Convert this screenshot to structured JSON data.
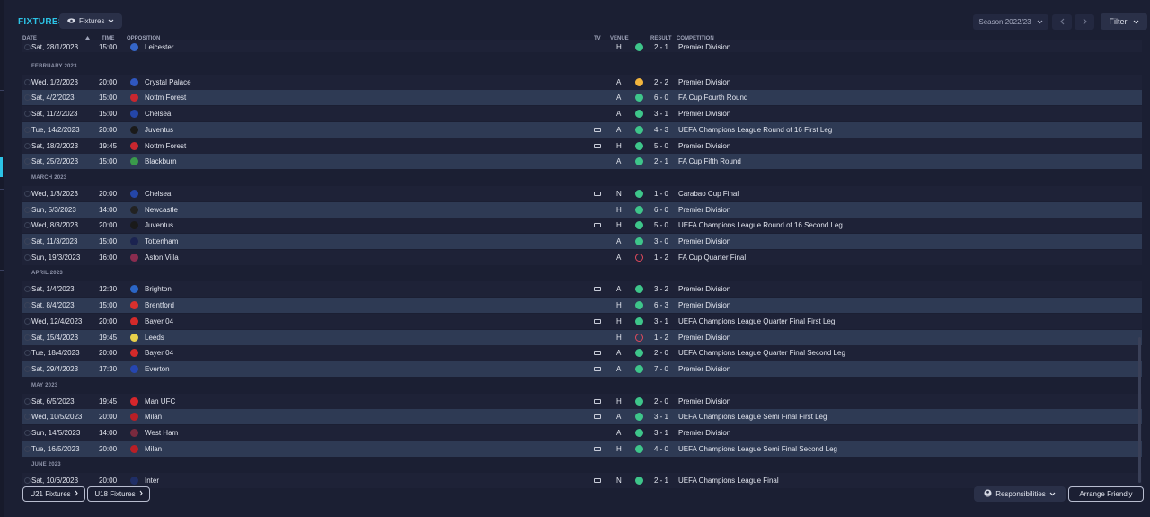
{
  "header": {
    "title": "FIXTURES",
    "view_dropdown": "Fixtures",
    "season": "Season 2022/23",
    "filter_label": "Filter"
  },
  "columns": {
    "date": "DATE",
    "time": "TIME",
    "opposition": "OPPOSITION",
    "tv": "TV",
    "venue": "VENUE",
    "result": "RESULT",
    "competition": "COMPETITION"
  },
  "fixtures": [
    {
      "date": "Sat, 28/1/2023",
      "time": "15:00",
      "opp": "Leicester",
      "tv": false,
      "venue": "H",
      "outcome": "win",
      "score": "2 - 1",
      "comp": "Premier Division",
      "crest": "#3566c9"
    },
    {
      "month": "FEBRUARY 2023"
    },
    {
      "date": "Wed, 1/2/2023",
      "time": "20:00",
      "opp": "Crystal Palace",
      "tv": false,
      "venue": "A",
      "outcome": "draw",
      "score": "2 - 2",
      "comp": "Premier Division",
      "crest": "#2f57c0"
    },
    {
      "date": "Sat, 4/2/2023",
      "time": "15:00",
      "opp": "Nottm Forest",
      "tv": false,
      "venue": "A",
      "outcome": "win",
      "score": "6 - 0",
      "comp": "FA Cup Fourth Round",
      "crest": "#c8272f"
    },
    {
      "date": "Sat, 11/2/2023",
      "time": "15:00",
      "opp": "Chelsea",
      "tv": false,
      "venue": "A",
      "outcome": "win",
      "score": "3 - 1",
      "comp": "Premier Division",
      "crest": "#2446a8"
    },
    {
      "date": "Tue, 14/2/2023",
      "time": "20:00",
      "opp": "Juventus",
      "tv": true,
      "venue": "A",
      "outcome": "win",
      "score": "4 - 3",
      "comp": "UEFA Champions League Round of 16  First Leg",
      "crest": "#1a1a1a"
    },
    {
      "date": "Sat, 18/2/2023",
      "time": "19:45",
      "opp": "Nottm Forest",
      "tv": true,
      "venue": "H",
      "outcome": "win",
      "score": "5 - 0",
      "comp": "Premier Division",
      "crest": "#c8272f"
    },
    {
      "date": "Sat, 25/2/2023",
      "time": "15:00",
      "opp": "Blackburn",
      "tv": false,
      "venue": "A",
      "outcome": "win",
      "score": "2 - 1",
      "comp": "FA Cup Fifth Round",
      "crest": "#3a9a4b"
    },
    {
      "month": "MARCH 2023"
    },
    {
      "date": "Wed, 1/3/2023",
      "time": "20:00",
      "opp": "Chelsea",
      "tv": true,
      "venue": "N",
      "outcome": "win",
      "score": "1 - 0",
      "comp": "Carabao Cup Final",
      "crest": "#2446a8"
    },
    {
      "date": "Sun, 5/3/2023",
      "time": "14:00",
      "opp": "Newcastle",
      "tv": false,
      "venue": "H",
      "outcome": "win",
      "score": "6 - 0",
      "comp": "Premier Division",
      "crest": "#222222"
    },
    {
      "date": "Wed, 8/3/2023",
      "time": "20:00",
      "opp": "Juventus",
      "tv": true,
      "venue": "H",
      "outcome": "win",
      "score": "5 - 0",
      "comp": "UEFA Champions League Round of 16  Second Leg",
      "crest": "#1a1a1a"
    },
    {
      "date": "Sat, 11/3/2023",
      "time": "15:00",
      "opp": "Tottenham",
      "tv": false,
      "venue": "A",
      "outcome": "win",
      "score": "3 - 0",
      "comp": "Premier Division",
      "crest": "#1b2350"
    },
    {
      "date": "Sun, 19/3/2023",
      "time": "16:00",
      "opp": "Aston Villa",
      "tv": false,
      "venue": "A",
      "outcome": "loss",
      "score": "1 - 2",
      "comp": "FA Cup Quarter Final",
      "crest": "#8a2c4f"
    },
    {
      "month": "APRIL 2023"
    },
    {
      "date": "Sat, 1/4/2023",
      "time": "12:30",
      "opp": "Brighton",
      "tv": true,
      "venue": "A",
      "outcome": "win",
      "score": "3 - 2",
      "comp": "Premier Division",
      "crest": "#2b66c6"
    },
    {
      "date": "Sat, 8/4/2023",
      "time": "15:00",
      "opp": "Brentford",
      "tv": false,
      "venue": "H",
      "outcome": "win",
      "score": "6 - 3",
      "comp": "Premier Division",
      "crest": "#d9302e"
    },
    {
      "date": "Wed, 12/4/2023",
      "time": "20:00",
      "opp": "Bayer 04",
      "tv": true,
      "venue": "H",
      "outcome": "win",
      "score": "3 - 1",
      "comp": "UEFA Champions League Quarter Final First Leg",
      "crest": "#d42a2a"
    },
    {
      "date": "Sat, 15/4/2023",
      "time": "19:45",
      "opp": "Leeds",
      "tv": false,
      "venue": "H",
      "outcome": "loss",
      "score": "1 - 2",
      "comp": "Premier Division",
      "crest": "#e8d04a"
    },
    {
      "date": "Tue, 18/4/2023",
      "time": "20:00",
      "opp": "Bayer 04",
      "tv": true,
      "venue": "A",
      "outcome": "win",
      "score": "2 - 0",
      "comp": "UEFA Champions League Quarter Final Second Leg",
      "crest": "#d42a2a"
    },
    {
      "date": "Sat, 29/4/2023",
      "time": "17:30",
      "opp": "Everton",
      "tv": true,
      "venue": "A",
      "outcome": "win",
      "score": "7 - 0",
      "comp": "Premier Division",
      "crest": "#2646b0"
    },
    {
      "month": "MAY 2023"
    },
    {
      "date": "Sat, 6/5/2023",
      "time": "19:45",
      "opp": "Man UFC",
      "tv": true,
      "venue": "H",
      "outcome": "win",
      "score": "2 - 0",
      "comp": "Premier Division",
      "crest": "#d6262b"
    },
    {
      "date": "Wed, 10/5/2023",
      "time": "20:00",
      "opp": "Milan",
      "tv": true,
      "venue": "A",
      "outcome": "win",
      "score": "3 - 1",
      "comp": "UEFA Champions League Semi Final First Leg",
      "crest": "#b91f26"
    },
    {
      "date": "Sun, 14/5/2023",
      "time": "14:00",
      "opp": "West Ham",
      "tv": false,
      "venue": "A",
      "outcome": "win",
      "score": "3 - 1",
      "comp": "Premier Division",
      "crest": "#7a2a3e"
    },
    {
      "date": "Tue, 16/5/2023",
      "time": "20:00",
      "opp": "Milan",
      "tv": true,
      "venue": "H",
      "outcome": "win",
      "score": "4 - 0",
      "comp": "UEFA Champions League Semi Final Second Leg",
      "crest": "#b91f26"
    },
    {
      "month": "JUNE 2023"
    },
    {
      "date": "Sat, 10/6/2023",
      "time": "20:00",
      "opp": "Inter",
      "tv": true,
      "venue": "N",
      "outcome": "win",
      "score": "2 - 1",
      "comp": "UEFA Champions League Final",
      "crest": "#1f2e66"
    }
  ],
  "footer": {
    "u21": "U21 Fixtures",
    "u18": "U18 Fixtures",
    "responsibilities": "Responsibilities",
    "arrange": "Arrange Friendly"
  },
  "colors": {
    "accent": "#2cc3e6",
    "win": "#3ec58a",
    "draw": "#f2b53d",
    "loss": "#e24a5d",
    "row_alt": "#2e3a54"
  }
}
